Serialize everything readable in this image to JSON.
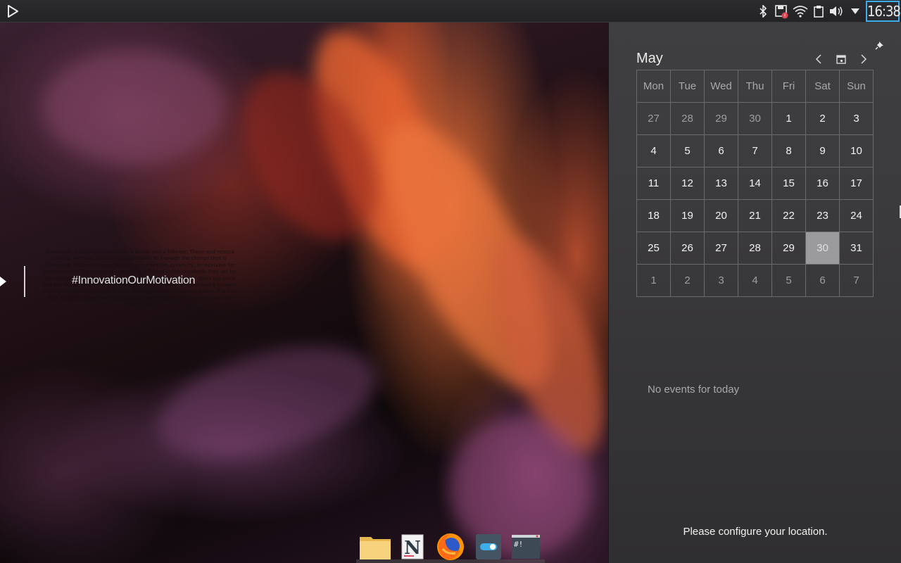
{
  "top_panel": {
    "clock": "16:38",
    "tray": [
      "bluetooth-icon",
      "usb-drive-icon",
      "wifi-icon",
      "clipboard-icon",
      "volume-icon",
      "expand-arrow-icon"
    ]
  },
  "quote_widget": {
    "hashtag": "#InnovationOurMotivation",
    "body": "Innovation distinguishes between a leader and a follower. These and related change we have a constant opportunity to manage the change that is inevitable. Without change there is no innovation, creativity, or incentive for improvement. The quality of a leader is reflected in the standards they set for themselves. Think little goals and expect little achievements. Think big goals and win big success. Innovation distinguishes between a leader and a follower. When your values are clear to you, making decisions becomes easier. It is true that integrity alone won't make you a leader, but without integrity you will never be one."
  },
  "dock": {
    "items": [
      "files-icon",
      "notes-app-icon",
      "firefox-icon",
      "settings-toggle-icon",
      "terminal-icon"
    ]
  },
  "calendar": {
    "month": "May",
    "weekdays": [
      "Mon",
      "Tue",
      "Wed",
      "Thu",
      "Fri",
      "Sat",
      "Sun"
    ],
    "weeks": [
      [
        "27",
        "28",
        "29",
        "30",
        "1",
        "2",
        "3"
      ],
      [
        "4",
        "5",
        "6",
        "7",
        "8",
        "9",
        "10"
      ],
      [
        "11",
        "12",
        "13",
        "14",
        "15",
        "16",
        "17"
      ],
      [
        "18",
        "19",
        "20",
        "21",
        "22",
        "23",
        "24"
      ],
      [
        "25",
        "26",
        "27",
        "28",
        "29",
        "30",
        "31"
      ],
      [
        "1",
        "2",
        "3",
        "4",
        "5",
        "6",
        "7"
      ]
    ],
    "today": "30",
    "no_events": "No events for today",
    "weather_message": "Please configure your location."
  },
  "colors": {
    "accent": "#3daee9",
    "today_bg": "#9b9a9c"
  }
}
